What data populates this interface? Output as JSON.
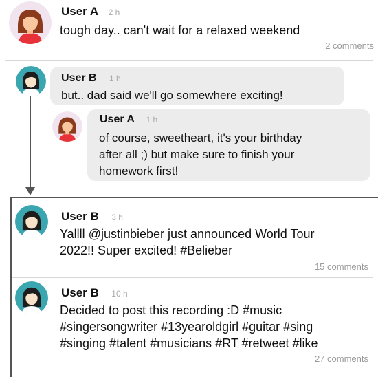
{
  "posts": [
    {
      "user": "User A",
      "time": "2 h",
      "text": "tough day.. can't wait for a relaxed weekend",
      "comments": "2 comments"
    },
    {
      "user": "User B",
      "time": "1 h",
      "text": "but.. dad said we'll go somewhere exciting!"
    },
    {
      "user": "User A",
      "time": "1 h",
      "text_lines": [
        "of course, sweetheart, it's your birthday",
        "after all ;) but make sure to finish your",
        "homework first!"
      ]
    },
    {
      "user": "User B",
      "time": "3 h",
      "text_lines": [
        "Yallll @justinbieber just announced World Tour",
        "2022!! Super excited! #Belieber"
      ],
      "comments": "15 comments"
    },
    {
      "user": "User B",
      "time": "10 h",
      "text_lines": [
        "Decided to post this recording :D #music",
        "#singersongwriter #13yearoldgirl #guitar #sing",
        "#singing #talent #musicians #RT #retweet #like"
      ],
      "comments": "27 comments"
    }
  ],
  "colors": {
    "avatar_a_bg": "#f1e4ef",
    "avatar_b_bg": "#3aa6b0",
    "bubble": "#ececec",
    "thread_line": "#555555"
  },
  "icons": {
    "user_a": "girl-avatar-icon",
    "user_b": "girl-avatar-icon"
  }
}
